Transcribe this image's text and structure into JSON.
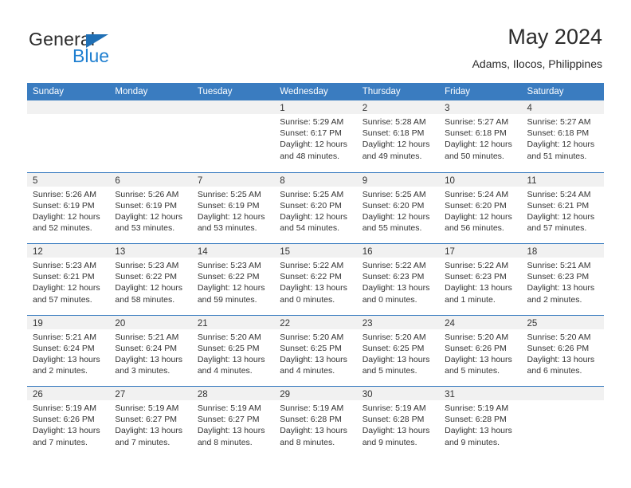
{
  "logo": {
    "word_top": "General",
    "word_bottom": "Blue",
    "triangle_color": "#1f6fb5",
    "blue_color": "#1f7fd0"
  },
  "header": {
    "title": "May 2024",
    "subtitle": "Adams, Ilocos, Philippines"
  },
  "theme": {
    "header_bar": "#3a7cc0",
    "day_band": "#f1f1f1",
    "text": "#333333"
  },
  "weekdays": [
    "Sunday",
    "Monday",
    "Tuesday",
    "Wednesday",
    "Thursday",
    "Friday",
    "Saturday"
  ],
  "weeks": [
    [
      {
        "day": "",
        "lines": []
      },
      {
        "day": "",
        "lines": []
      },
      {
        "day": "",
        "lines": []
      },
      {
        "day": "1",
        "lines": [
          "Sunrise: 5:29 AM",
          "Sunset: 6:17 PM",
          "Daylight: 12 hours",
          "and 48 minutes."
        ]
      },
      {
        "day": "2",
        "lines": [
          "Sunrise: 5:28 AM",
          "Sunset: 6:18 PM",
          "Daylight: 12 hours",
          "and 49 minutes."
        ]
      },
      {
        "day": "3",
        "lines": [
          "Sunrise: 5:27 AM",
          "Sunset: 6:18 PM",
          "Daylight: 12 hours",
          "and 50 minutes."
        ]
      },
      {
        "day": "4",
        "lines": [
          "Sunrise: 5:27 AM",
          "Sunset: 6:18 PM",
          "Daylight: 12 hours",
          "and 51 minutes."
        ]
      }
    ],
    [
      {
        "day": "5",
        "lines": [
          "Sunrise: 5:26 AM",
          "Sunset: 6:19 PM",
          "Daylight: 12 hours",
          "and 52 minutes."
        ]
      },
      {
        "day": "6",
        "lines": [
          "Sunrise: 5:26 AM",
          "Sunset: 6:19 PM",
          "Daylight: 12 hours",
          "and 53 minutes."
        ]
      },
      {
        "day": "7",
        "lines": [
          "Sunrise: 5:25 AM",
          "Sunset: 6:19 PM",
          "Daylight: 12 hours",
          "and 53 minutes."
        ]
      },
      {
        "day": "8",
        "lines": [
          "Sunrise: 5:25 AM",
          "Sunset: 6:20 PM",
          "Daylight: 12 hours",
          "and 54 minutes."
        ]
      },
      {
        "day": "9",
        "lines": [
          "Sunrise: 5:25 AM",
          "Sunset: 6:20 PM",
          "Daylight: 12 hours",
          "and 55 minutes."
        ]
      },
      {
        "day": "10",
        "lines": [
          "Sunrise: 5:24 AM",
          "Sunset: 6:20 PM",
          "Daylight: 12 hours",
          "and 56 minutes."
        ]
      },
      {
        "day": "11",
        "lines": [
          "Sunrise: 5:24 AM",
          "Sunset: 6:21 PM",
          "Daylight: 12 hours",
          "and 57 minutes."
        ]
      }
    ],
    [
      {
        "day": "12",
        "lines": [
          "Sunrise: 5:23 AM",
          "Sunset: 6:21 PM",
          "Daylight: 12 hours",
          "and 57 minutes."
        ]
      },
      {
        "day": "13",
        "lines": [
          "Sunrise: 5:23 AM",
          "Sunset: 6:22 PM",
          "Daylight: 12 hours",
          "and 58 minutes."
        ]
      },
      {
        "day": "14",
        "lines": [
          "Sunrise: 5:23 AM",
          "Sunset: 6:22 PM",
          "Daylight: 12 hours",
          "and 59 minutes."
        ]
      },
      {
        "day": "15",
        "lines": [
          "Sunrise: 5:22 AM",
          "Sunset: 6:22 PM",
          "Daylight: 13 hours",
          "and 0 minutes."
        ]
      },
      {
        "day": "16",
        "lines": [
          "Sunrise: 5:22 AM",
          "Sunset: 6:23 PM",
          "Daylight: 13 hours",
          "and 0 minutes."
        ]
      },
      {
        "day": "17",
        "lines": [
          "Sunrise: 5:22 AM",
          "Sunset: 6:23 PM",
          "Daylight: 13 hours",
          "and 1 minute."
        ]
      },
      {
        "day": "18",
        "lines": [
          "Sunrise: 5:21 AM",
          "Sunset: 6:23 PM",
          "Daylight: 13 hours",
          "and 2 minutes."
        ]
      }
    ],
    [
      {
        "day": "19",
        "lines": [
          "Sunrise: 5:21 AM",
          "Sunset: 6:24 PM",
          "Daylight: 13 hours",
          "and 2 minutes."
        ]
      },
      {
        "day": "20",
        "lines": [
          "Sunrise: 5:21 AM",
          "Sunset: 6:24 PM",
          "Daylight: 13 hours",
          "and 3 minutes."
        ]
      },
      {
        "day": "21",
        "lines": [
          "Sunrise: 5:20 AM",
          "Sunset: 6:25 PM",
          "Daylight: 13 hours",
          "and 4 minutes."
        ]
      },
      {
        "day": "22",
        "lines": [
          "Sunrise: 5:20 AM",
          "Sunset: 6:25 PM",
          "Daylight: 13 hours",
          "and 4 minutes."
        ]
      },
      {
        "day": "23",
        "lines": [
          "Sunrise: 5:20 AM",
          "Sunset: 6:25 PM",
          "Daylight: 13 hours",
          "and 5 minutes."
        ]
      },
      {
        "day": "24",
        "lines": [
          "Sunrise: 5:20 AM",
          "Sunset: 6:26 PM",
          "Daylight: 13 hours",
          "and 5 minutes."
        ]
      },
      {
        "day": "25",
        "lines": [
          "Sunrise: 5:20 AM",
          "Sunset: 6:26 PM",
          "Daylight: 13 hours",
          "and 6 minutes."
        ]
      }
    ],
    [
      {
        "day": "26",
        "lines": [
          "Sunrise: 5:19 AM",
          "Sunset: 6:26 PM",
          "Daylight: 13 hours",
          "and 7 minutes."
        ]
      },
      {
        "day": "27",
        "lines": [
          "Sunrise: 5:19 AM",
          "Sunset: 6:27 PM",
          "Daylight: 13 hours",
          "and 7 minutes."
        ]
      },
      {
        "day": "28",
        "lines": [
          "Sunrise: 5:19 AM",
          "Sunset: 6:27 PM",
          "Daylight: 13 hours",
          "and 8 minutes."
        ]
      },
      {
        "day": "29",
        "lines": [
          "Sunrise: 5:19 AM",
          "Sunset: 6:28 PM",
          "Daylight: 13 hours",
          "and 8 minutes."
        ]
      },
      {
        "day": "30",
        "lines": [
          "Sunrise: 5:19 AM",
          "Sunset: 6:28 PM",
          "Daylight: 13 hours",
          "and 9 minutes."
        ]
      },
      {
        "day": "31",
        "lines": [
          "Sunrise: 5:19 AM",
          "Sunset: 6:28 PM",
          "Daylight: 13 hours",
          "and 9 minutes."
        ]
      },
      {
        "day": "",
        "lines": []
      }
    ]
  ]
}
